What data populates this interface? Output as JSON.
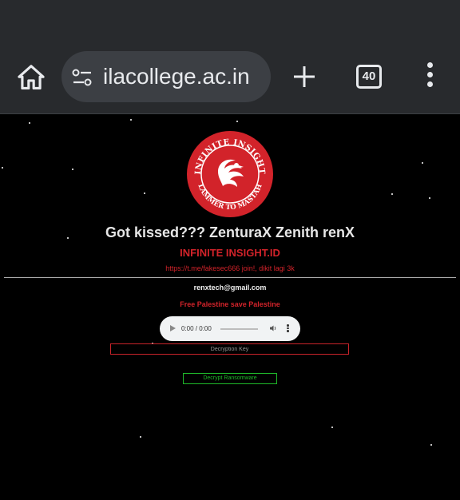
{
  "browser": {
    "url": "ilacollege.ac.in",
    "tab_count": "40"
  },
  "page": {
    "logo_text_top": "INFINITE INSIGHT",
    "logo_text_bottom": "LAMMER TO MASTAH",
    "headline": "Got kissed??? ZenturaX Zenith renX",
    "site_name": "INFINITE INSIGHT.ID",
    "telegram_line": "https://t.me/fakesec666 join!, dikit lagi 3k",
    "email": "renxtech@gmail.com",
    "slogan": "Free Palestine save Palestine",
    "audio_time": "0:00 / 0:00",
    "key_placeholder": "Decryption Key",
    "decrypt_label": "Decrypt Ransomware"
  },
  "colors": {
    "accent_red": "#d2232a",
    "accent_green": "#1fb82a",
    "toolbar": "#282a2d"
  },
  "icons": [
    "home-icon",
    "site-settings-icon",
    "plus-icon",
    "tab-switcher-icon",
    "more-vert-icon",
    "play-icon",
    "volume-icon",
    "phoenix-logo"
  ]
}
